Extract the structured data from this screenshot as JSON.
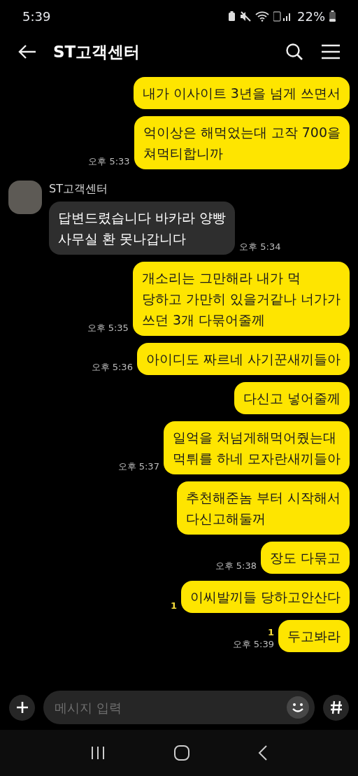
{
  "status_bar": {
    "time": "5:39",
    "battery": "22%"
  },
  "header": {
    "title": "ST고객센터"
  },
  "messages": [
    {
      "kind": "sent",
      "text": "내가 이사이트 3년을 넘게 쓰면서"
    },
    {
      "kind": "sent",
      "text": "억이상은 해먹었는대 고작 700을\n쳐먹티합니까",
      "time": "오후 5:33"
    },
    {
      "kind": "received",
      "sender": "ST고객센터",
      "text": "답변드렸습니다 바카라 양빵\n사무실 환 못나갑니다",
      "time": "오후 5:34"
    },
    {
      "kind": "sent",
      "text": "개소리는 그만해라 내가 먹\n당하고 가만히 있을거같나 너가가\n쓰던 3개 다묶어줄께",
      "time": "오후 5:35"
    },
    {
      "kind": "sent",
      "text": "아이디도 짜르네 사기꾼새끼들아",
      "time": "오후 5:36"
    },
    {
      "kind": "sent",
      "text": "다신고 넣어줄께"
    },
    {
      "kind": "sent",
      "text": "일억을 처넘게해먹어줬는대\n먹튀를 하네  모자란새끼들아",
      "time": "오후 5:37"
    },
    {
      "kind": "sent",
      "text": "추천해준놈 부터 시작해서\n다신고해둘꺼"
    },
    {
      "kind": "sent",
      "text": "장도 다묶고",
      "time": "오후 5:38"
    },
    {
      "kind": "sent",
      "text": "이씨발끼들 당하고안산다",
      "unread": "1"
    },
    {
      "kind": "sent",
      "text": "두고봐라",
      "unread": "1",
      "time": "오후 5:39"
    }
  ],
  "composer": {
    "placeholder": "메시지 입력"
  }
}
